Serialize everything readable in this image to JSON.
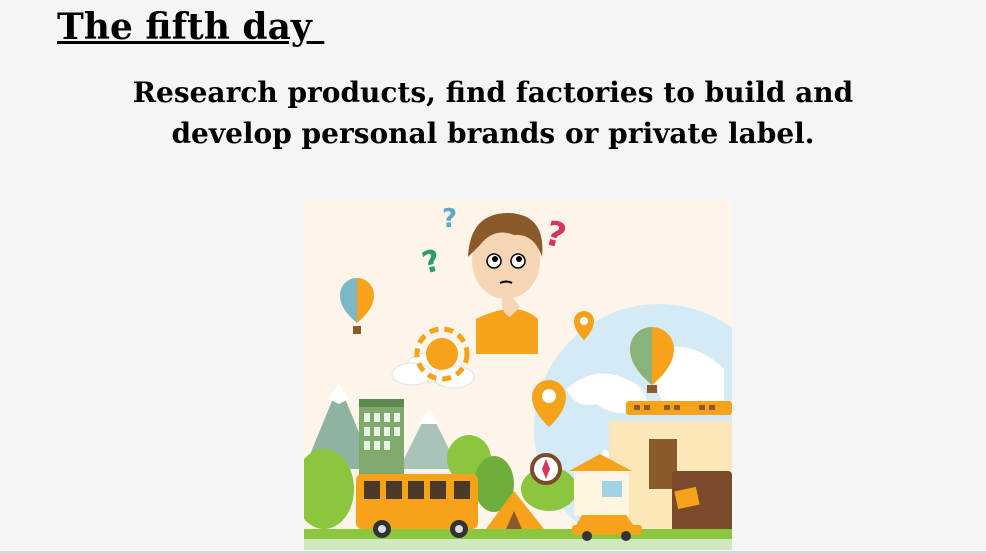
{
  "slide": {
    "title": "The fifth day ",
    "subtitle": "Research products, find factories to build and develop personal brands or private label."
  },
  "illustration": {
    "icons": [
      "question-mark-icon",
      "location-pin-icon",
      "hot-air-balloon-icon",
      "sun-icon",
      "compass-icon"
    ],
    "colors": {
      "background": "#fdf5ea",
      "orange": "#f7a21b",
      "green": "#8cc63f",
      "globe": "#cfe8f3"
    }
  }
}
